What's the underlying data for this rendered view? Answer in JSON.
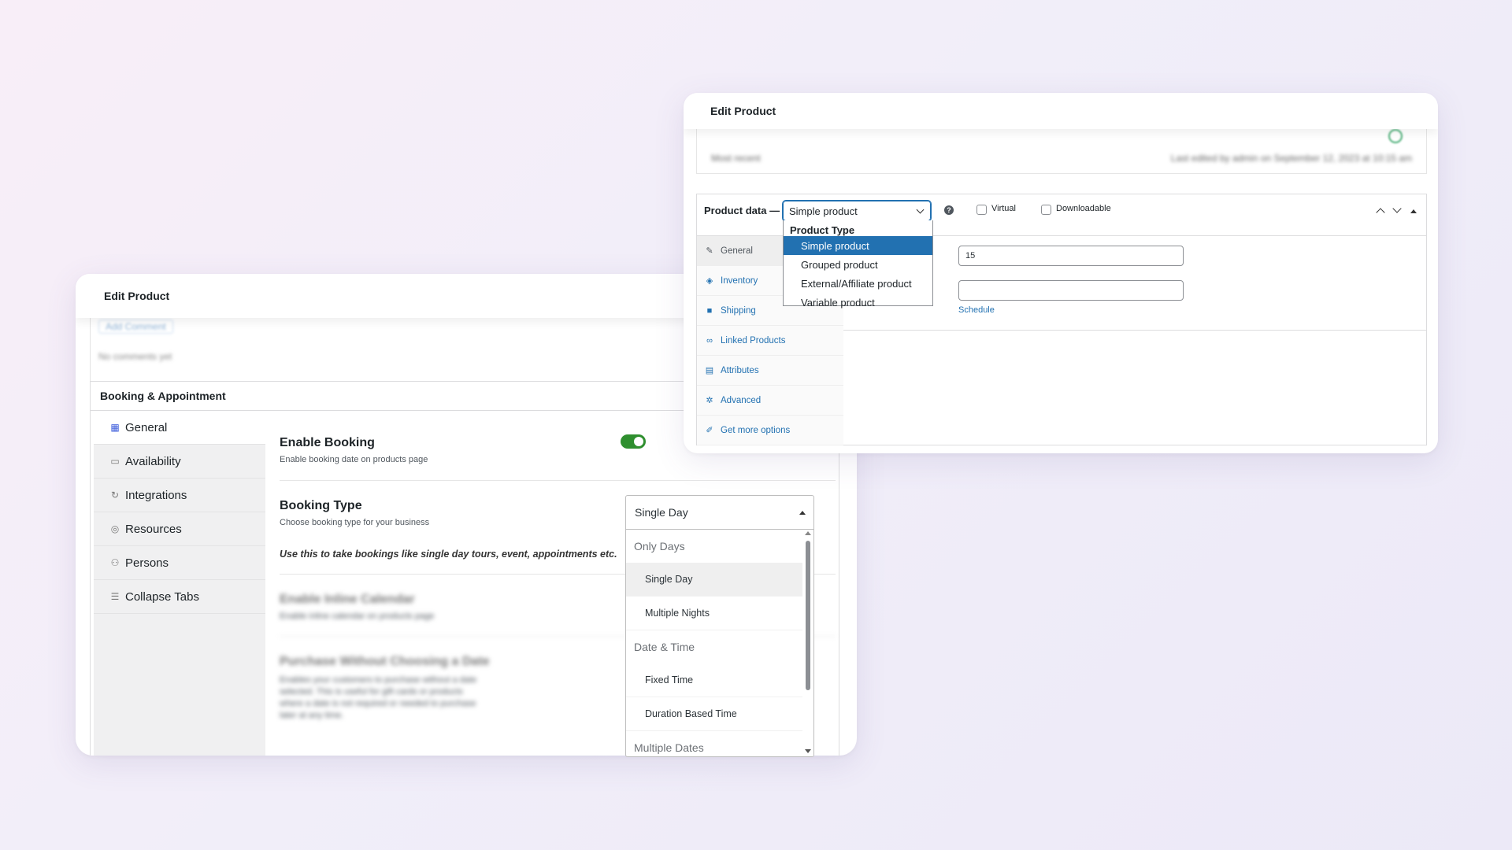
{
  "left_card": {
    "header_title": "Edit Product",
    "blur_comment_button": "Add Comment",
    "blur_comment_text": "No comments yet",
    "panel_title": "Booking & Appointment",
    "tabs": [
      {
        "label": "General",
        "icon": "grid-icon"
      },
      {
        "label": "Availability",
        "icon": "calendar-icon"
      },
      {
        "label": "Integrations",
        "icon": "sync-icon"
      },
      {
        "label": "Resources",
        "icon": "globe-icon"
      },
      {
        "label": "Persons",
        "icon": "persons-icon"
      },
      {
        "label": "Collapse Tabs",
        "icon": "list-icon"
      }
    ],
    "enable_booking": {
      "heading": "Enable Booking",
      "description": "Enable booking date on products page",
      "enabled": true
    },
    "booking_type": {
      "heading": "Booking Type",
      "description": "Choose booking type for your business",
      "note": "Use this to take bookings like single day tours, event, appointments etc.",
      "selected": "Single Day"
    },
    "blurred": {
      "inline_heading": "Enable Inline Calendar",
      "inline_desc": "Enable inline calendar on products page",
      "purchase_heading": "Purchase Without Choosing a Date",
      "purchase_lines": [
        "Enables your customers to purchase without a date",
        "selected. This is useful for gift cards or products",
        "where a date is not required or needed to purchase",
        "later at any time."
      ]
    },
    "dropdown": {
      "groups": [
        {
          "label": "Only Days",
          "options": [
            "Single Day",
            "Multiple Nights"
          ]
        },
        {
          "label": "Date & Time",
          "options": [
            "Fixed Time",
            "Duration Based Time"
          ]
        },
        {
          "label": "Multiple Dates",
          "options": []
        }
      ]
    }
  },
  "right_card": {
    "header_title": "Edit Product",
    "blur_left": "Most recent",
    "blur_right": "Last edited by admin on September 12, 2023 at 10:15 am",
    "product_data_label": "Product data —",
    "product_type_selected": "Simple product",
    "virtual_label": "Virtual",
    "downloadable_label": "Downloadable",
    "tabs": [
      {
        "label": "General",
        "icon": "wrench-icon"
      },
      {
        "label": "Inventory",
        "icon": "tag-icon"
      },
      {
        "label": "Shipping",
        "icon": "truck-icon"
      },
      {
        "label": "Linked Products",
        "icon": "link-icon"
      },
      {
        "label": "Attributes",
        "icon": "table-icon"
      },
      {
        "label": "Advanced",
        "icon": "gear-icon"
      },
      {
        "label": "Get more options",
        "icon": "plugin-icon"
      }
    ],
    "regular_price_value": "15",
    "sale_price_value": "",
    "schedule_link": "Schedule",
    "product_type_dropdown": {
      "group_label": "Product Type",
      "options": [
        "Simple product",
        "Grouped product",
        "External/Affiliate product",
        "Variable product"
      ]
    }
  },
  "colors": {
    "toggle_on": "#2f8f2f",
    "wp_blue": "#2271b1",
    "highlight": "#2271b1"
  }
}
